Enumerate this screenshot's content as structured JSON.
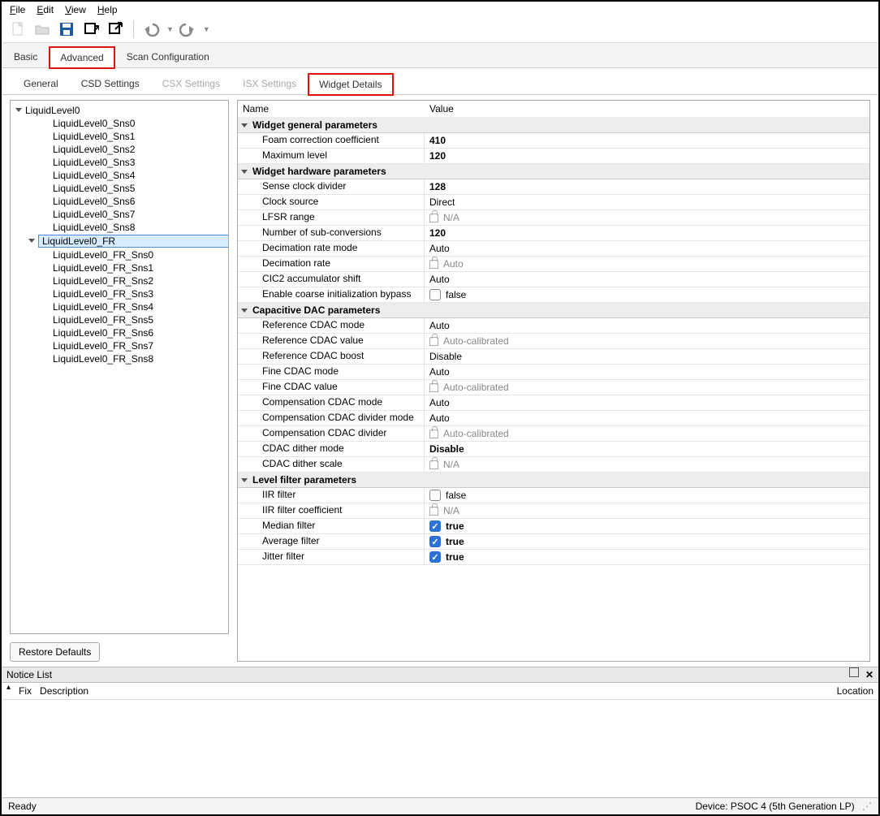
{
  "menu": {
    "file": "File",
    "edit": "Edit",
    "view": "View",
    "help": "Help"
  },
  "toptabs": {
    "basic": "Basic",
    "advanced": "Advanced",
    "scan": "Scan Configuration"
  },
  "subtabs": {
    "general": "General",
    "csd": "CSD Settings",
    "csx": "CSX Settings",
    "isx": "ISX Settings",
    "widget": "Widget Details"
  },
  "tree": {
    "n0": "LiquidLevel0",
    "n0c": [
      "LiquidLevel0_Sns0",
      "LiquidLevel0_Sns1",
      "LiquidLevel0_Sns2",
      "LiquidLevel0_Sns3",
      "LiquidLevel0_Sns4",
      "LiquidLevel0_Sns5",
      "LiquidLevel0_Sns6",
      "LiquidLevel0_Sns7",
      "LiquidLevel0_Sns8"
    ],
    "n1": "LiquidLevel0_FR",
    "n1c": [
      "LiquidLevel0_FR_Sns0",
      "LiquidLevel0_FR_Sns1",
      "LiquidLevel0_FR_Sns2",
      "LiquidLevel0_FR_Sns3",
      "LiquidLevel0_FR_Sns4",
      "LiquidLevel0_FR_Sns5",
      "LiquidLevel0_FR_Sns6",
      "LiquidLevel0_FR_Sns7",
      "LiquidLevel0_FR_Sns8"
    ]
  },
  "buttons": {
    "restore": "Restore Defaults"
  },
  "propheader": {
    "name": "Name",
    "value": "Value"
  },
  "sections": {
    "general": "Widget general parameters",
    "hardware": "Widget hardware parameters",
    "cdac": "Capacitive DAC parameters",
    "filter": "Level filter parameters"
  },
  "props": {
    "foam_n": "Foam correction coefficient",
    "foam_v": "410",
    "maxlvl_n": "Maximum level",
    "maxlvl_v": "120",
    "scd_n": "Sense clock divider",
    "scd_v": "128",
    "cs_n": "Clock source",
    "cs_v": "Direct",
    "lfsr_n": "LFSR range",
    "lfsr_v": "N/A",
    "nsc_n": "Number of sub-conversions",
    "nsc_v": "120",
    "drm_n": "Decimation rate mode",
    "drm_v": "Auto",
    "dr_n": "Decimation rate",
    "dr_v": "Auto",
    "cic2_n": "CIC2 accumulator shift",
    "cic2_v": "Auto",
    "ecib_n": "Enable coarse initialization bypass",
    "ecib_v": "false",
    "rcm_n": "Reference CDAC mode",
    "rcm_v": "Auto",
    "rcv_n": "Reference CDAC value",
    "rcv_v": "Auto-calibrated",
    "rcb_n": "Reference CDAC boost",
    "rcb_v": "Disable",
    "fcm_n": "Fine CDAC mode",
    "fcm_v": "Auto",
    "fcv_n": "Fine CDAC value",
    "fcv_v": "Auto-calibrated",
    "ccm_n": "Compensation CDAC mode",
    "ccm_v": "Auto",
    "ccdm_n": "Compensation CDAC divider mode",
    "ccdm_v": "Auto",
    "ccd_n": "Compensation CDAC divider",
    "ccd_v": "Auto-calibrated",
    "cdm_n": "CDAC dither mode",
    "cdm_v": "Disable",
    "cds_n": "CDAC dither scale",
    "cds_v": "N/A",
    "iir_n": "IIR filter",
    "iir_v": "false",
    "iirc_n": "IIR filter coefficient",
    "iirc_v": "N/A",
    "med_n": "Median filter",
    "med_v": "true",
    "avg_n": "Average filter",
    "avg_v": "true",
    "jit_n": "Jitter filter",
    "jit_v": "true"
  },
  "notice": {
    "title": "Notice List",
    "fix": "Fix",
    "desc": "Description",
    "loc": "Location"
  },
  "status": {
    "ready": "Ready",
    "device": "Device: PSOC 4 (5th Generation LP)"
  }
}
